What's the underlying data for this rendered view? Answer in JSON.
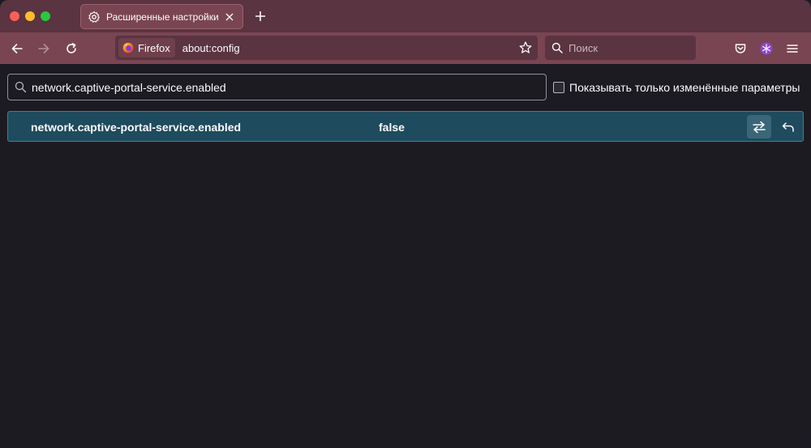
{
  "window": {
    "tab_title": "Расширенные настройки"
  },
  "toolbar": {
    "identity_label": "Firefox",
    "url": "about:config",
    "search_placeholder": "Поиск"
  },
  "config": {
    "filter_value": "network.captive-portal-service.enabled",
    "show_modified_label": "Показывать только изменённые параметры",
    "rows": [
      {
        "name": "network.captive-portal-service.enabled",
        "value": "false"
      }
    ]
  },
  "colors": {
    "tabstrip": "#5a3440",
    "toolbar": "#7a4553",
    "content_bg": "#1c1b22",
    "row_highlight": "#1e4b5d"
  }
}
